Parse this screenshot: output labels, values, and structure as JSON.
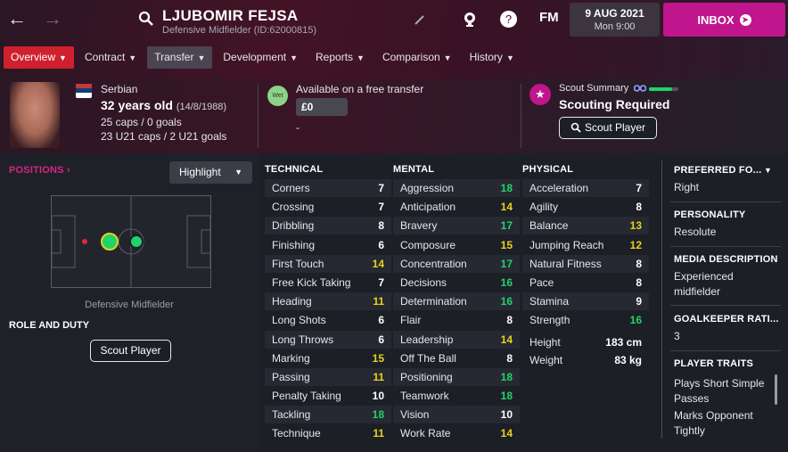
{
  "header": {
    "player_name": "LJUBOMIR FEJSA",
    "subtitle": "Defensive Midfielder (ID:62000815)",
    "fm_label": "FM",
    "date": "9 AUG 2021",
    "day_time": "Mon 9:00",
    "inbox_label": "INBOX"
  },
  "tabs": [
    {
      "label": "Overview"
    },
    {
      "label": "Contract"
    },
    {
      "label": "Transfer"
    },
    {
      "label": "Development"
    },
    {
      "label": "Reports"
    },
    {
      "label": "Comparison"
    },
    {
      "label": "History"
    }
  ],
  "info": {
    "nationality": "Serbian",
    "age": "32 years old",
    "dob": "(14/8/1988)",
    "caps": "25 caps / 0 goals",
    "u21_caps": "23 U21 caps / 2 U21 goals",
    "transfer_status": "Available on a free transfer",
    "wet_label": "Wet",
    "fee": "£0",
    "fee_dash": "-",
    "scout_summary_label": "Scout Summary",
    "scouting_status": "Scouting Required",
    "scout_knowledge": 0.8,
    "scout_player_button": "Scout Player"
  },
  "positions": {
    "label": "POSITIONS",
    "highlight_label": "Highlight",
    "position_name": "Defensive Midfielder",
    "role_duty_label": "ROLE AND DUTY",
    "role_button": "Scout Player"
  },
  "attributes": {
    "technical_label": "TECHNICAL",
    "mental_label": "MENTAL",
    "physical_label": "PHYSICAL",
    "technical": [
      {
        "name": "Corners",
        "value": "7"
      },
      {
        "name": "Crossing",
        "value": "7"
      },
      {
        "name": "Dribbling",
        "value": "8"
      },
      {
        "name": "Finishing",
        "value": "6"
      },
      {
        "name": "First Touch",
        "value": "14"
      },
      {
        "name": "Free Kick Taking",
        "value": "7"
      },
      {
        "name": "Heading",
        "value": "11"
      },
      {
        "name": "Long Shots",
        "value": "6"
      },
      {
        "name": "Long Throws",
        "value": "6"
      },
      {
        "name": "Marking",
        "value": "15"
      },
      {
        "name": "Passing",
        "value": "11"
      },
      {
        "name": "Penalty Taking",
        "value": "10"
      },
      {
        "name": "Tackling",
        "value": "18"
      },
      {
        "name": "Technique",
        "value": "11"
      }
    ],
    "mental": [
      {
        "name": "Aggression",
        "value": "18"
      },
      {
        "name": "Anticipation",
        "value": "14"
      },
      {
        "name": "Bravery",
        "value": "17"
      },
      {
        "name": "Composure",
        "value": "15"
      },
      {
        "name": "Concentration",
        "value": "17"
      },
      {
        "name": "Decisions",
        "value": "16"
      },
      {
        "name": "Determination",
        "value": "16"
      },
      {
        "name": "Flair",
        "value": "8"
      },
      {
        "name": "Leadership",
        "value": "14"
      },
      {
        "name": "Off The Ball",
        "value": "8"
      },
      {
        "name": "Positioning",
        "value": "18"
      },
      {
        "name": "Teamwork",
        "value": "18"
      },
      {
        "name": "Vision",
        "value": "10"
      },
      {
        "name": "Work Rate",
        "value": "14"
      }
    ],
    "physical": [
      {
        "name": "Acceleration",
        "value": "7"
      },
      {
        "name": "Agility",
        "value": "8"
      },
      {
        "name": "Balance",
        "value": "13"
      },
      {
        "name": "Jumping Reach",
        "value": "12"
      },
      {
        "name": "Natural Fitness",
        "value": "8"
      },
      {
        "name": "Pace",
        "value": "8"
      },
      {
        "name": "Stamina",
        "value": "9"
      },
      {
        "name": "Strength",
        "value": "16"
      }
    ],
    "height_label": "Height",
    "height": "183 cm",
    "weight_label": "Weight",
    "weight": "83 kg"
  },
  "side": {
    "preferred_foot_label": "PREFERRED FO...",
    "preferred_foot": "Right",
    "personality_label": "PERSONALITY",
    "personality": "Resolute",
    "media_label": "MEDIA DESCRIPTION",
    "media_line1": "Experienced",
    "media_line2": "midfielder",
    "gk_label": "GOALKEEPER RATI...",
    "gk_value": "3",
    "traits_label": "PLAYER TRAITS",
    "trait1_line1": "Plays Short Simple",
    "trait1_line2": "Passes",
    "trait2_line1": "Marks Opponent",
    "trait2_line2": "Tightly"
  },
  "colors": {
    "accent": "#d0202e",
    "inbox": "#c0158c",
    "attr_white": "#ffffff",
    "attr_yellow": "#e8d21d",
    "attr_green": "#22d36b"
  }
}
